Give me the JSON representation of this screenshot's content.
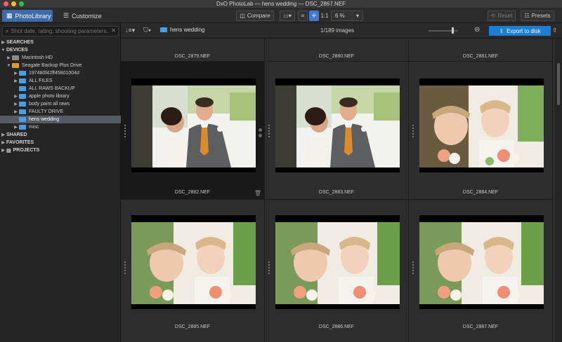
{
  "window": {
    "title": "DxO PhotoLab — hens wedding — DSC_2867.NEF"
  },
  "toolbar": {
    "tabs": [
      {
        "label": "PhotoLibrary"
      },
      {
        "label": "Customize"
      }
    ],
    "compare_label": "Compare",
    "zoom_fit_label": "1:1",
    "zoom_value": "6 %",
    "reset_label": "Reset",
    "presets_label": "Presets"
  },
  "sidebar": {
    "search_placeholder": "Shot date, rating, shooting parameters...",
    "sections": {
      "searches": "SEARCHES",
      "devices": "DEVICES",
      "shared": "SHARED",
      "favorites": "FAVORITES",
      "projects": "PROJECTS"
    },
    "devices": [
      {
        "label": "Macintosh HD"
      },
      {
        "label": "Seagate Backup Plus Drive"
      }
    ],
    "folders": [
      {
        "label": "197480f42ff45801004d"
      },
      {
        "label": "ALL FILES"
      },
      {
        "label": "ALL RAWS BACKUP"
      },
      {
        "label": "apple photo library"
      },
      {
        "label": "body paint all raws"
      },
      {
        "label": "FAULTY DRIVE"
      },
      {
        "label": "hens wedding"
      },
      {
        "label": "misc"
      }
    ]
  },
  "browser": {
    "folder_name": "hens wedding",
    "image_count": "1/189 images",
    "export_label": "Export to disk"
  },
  "images": {
    "top_row": [
      "DSC_2879.NEF",
      "DSC_2880.NEF",
      "DSC_2881.NEF"
    ],
    "row1": [
      "DSC_2882.NEF",
      "DSC_2883.NEF",
      "DSC_2884.NEF"
    ],
    "row2": [
      "DSC_2885.NEF",
      "DSC_2886.NEF",
      "DSC_2887.NEF"
    ]
  },
  "colors": {
    "accent": "#3d7bd1",
    "folder": "#4a9fe3",
    "export": "#1d7fd3"
  }
}
